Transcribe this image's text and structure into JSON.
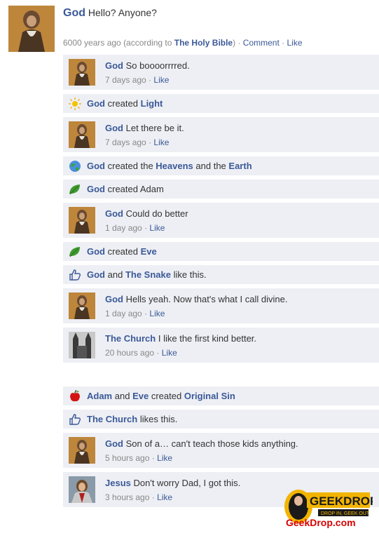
{
  "status": {
    "author": "God",
    "text": "Hello?  Anyone?",
    "time": "6000 years ago (according to ",
    "source": "The Holy Bible",
    "time_close": ")",
    "comment": "Comment",
    "like": "Like",
    "sep": "·"
  },
  "feed": [
    {
      "kind": "comment",
      "name": "God",
      "text": "So boooorrrred.",
      "time": "7 days ago",
      "like": "Like",
      "avatar": "god"
    },
    {
      "kind": "story",
      "icon": "sun-icon",
      "name": "God",
      "mid": "created",
      "obj": "Light",
      "rest": "",
      "obj2": ""
    },
    {
      "kind": "comment",
      "name": "God",
      "text": "Let there be it.",
      "time": "7 days ago",
      "like": "Like",
      "avatar": "god"
    },
    {
      "kind": "story",
      "icon": "earth-icon",
      "name": "God",
      "mid": "created the",
      "obj": "Heavens",
      "rest": "and the",
      "obj2": "Earth"
    },
    {
      "kind": "story",
      "icon": "leaf-icon",
      "name": "God",
      "mid": "created Adam",
      "obj": "",
      "rest": "",
      "obj2": ""
    },
    {
      "kind": "comment",
      "name": "God",
      "text": "Could do better",
      "time": "1 day ago",
      "like": "Like",
      "avatar": "god"
    },
    {
      "kind": "story",
      "icon": "leaf-icon",
      "name": "God",
      "mid": "created",
      "obj": "Eve",
      "rest": "",
      "obj2": ""
    },
    {
      "kind": "like",
      "name": "God",
      "mid": "and",
      "name2": "The Snake",
      "rest": "like this."
    },
    {
      "kind": "comment",
      "name": "God",
      "text": "Hells yeah.  Now that's what I call divine.",
      "time": "1 day ago",
      "like": "Like",
      "avatar": "god"
    },
    {
      "kind": "comment",
      "name": "The Church",
      "text": "I like the first kind better.",
      "time": "20 hours ago",
      "like": "Like",
      "avatar": "church"
    },
    {
      "kind": "gap"
    },
    {
      "kind": "story",
      "icon": "apple-icon",
      "name": "Adam",
      "mid": "and",
      "obj": "Eve",
      "rest": "created",
      "obj2": "Original Sin",
      "namestyle": "plain"
    },
    {
      "kind": "like",
      "name": "The Church",
      "mid": "",
      "name2": "",
      "rest": "likes this."
    },
    {
      "kind": "comment",
      "name": "God",
      "text": "Son of a… can't teach those kids anything.",
      "time": "5 hours ago",
      "like": "Like",
      "avatar": "god"
    },
    {
      "kind": "comment",
      "name": "Jesus",
      "text": "Don't worry Dad, I got this.",
      "time": "3 hours ago",
      "like": "Like",
      "avatar": "jesus"
    }
  ],
  "logo": {
    "line1": "GEEKDROP",
    "line2": "DROP IN, GEEK OUT",
    "line3": "GeekDrop.com"
  },
  "colors": {
    "link": "#3b5998",
    "feed_bg": "#edeff4",
    "meta": "#888888"
  }
}
